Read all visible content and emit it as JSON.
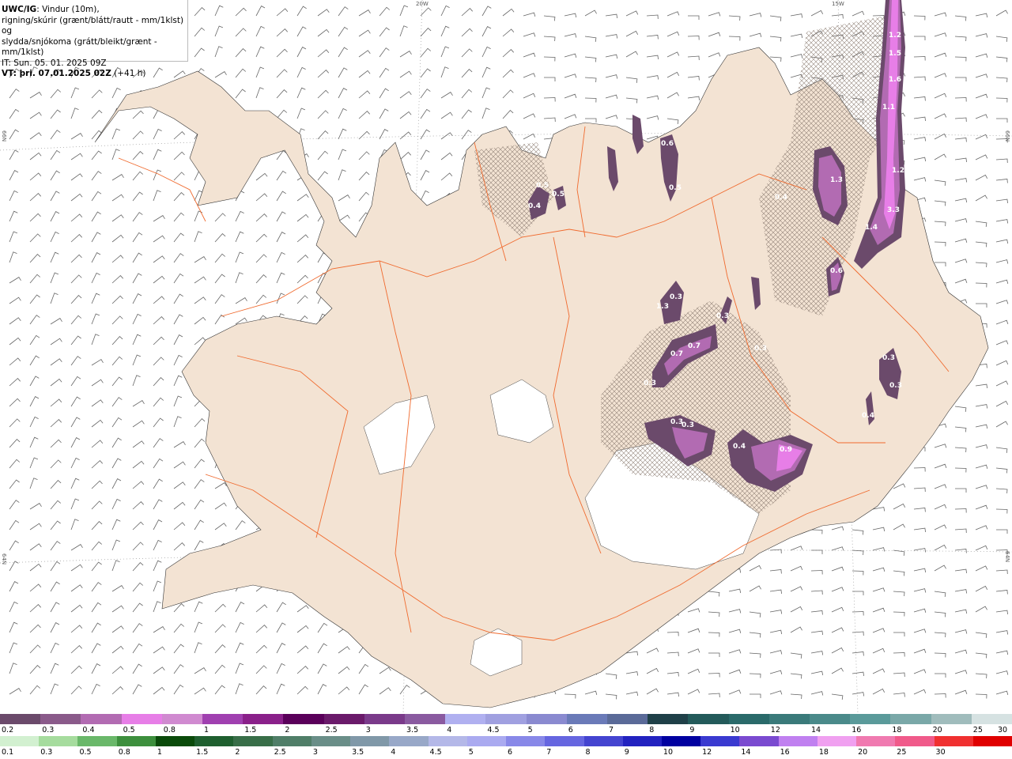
{
  "title": {
    "model": "UWC/IG",
    "line1_rest": ": Vindur (10m),",
    "line2": "rigning/skúrir (grænt/blátt/rautt - mm/1klst) og",
    "line3": "slydda/snjókoma (grátt/bleikt/grænt - mm/1klst)",
    "it_line": "IT: Sun. 05. 01. 2025 09Z",
    "vt_label": "VT: þri. 07.01.2025 02Z",
    "vt_offset": " (+41 h)"
  },
  "coords": {
    "top_20w": "20W",
    "top_15w": "15W",
    "left_66n": "66N",
    "left_64n": "64N",
    "right_66n": "66N",
    "right_64n": "64N"
  },
  "colors": {
    "land": "#f3e3d3",
    "road": "#f06a2e",
    "glacier": "#ffffff",
    "sea": "#ffffff",
    "wind_barb": "#666666"
  },
  "precip_labels": [
    "1.2",
    "1.5",
    "1.6",
    "1.1",
    "1.2",
    "3.3",
    "1.4",
    "1.3",
    "0.6",
    "0.6",
    "0.5",
    "0.5",
    "0.4",
    "0.5",
    "0.4",
    "1.3",
    "0.3",
    "0.3",
    "0.4",
    "0.7",
    "0.7",
    "0.3",
    "0.3",
    "0.3",
    "0.3",
    "0.4",
    "0.9",
    "0.3",
    "0.3"
  ],
  "legend_snow": {
    "colors": [
      "#6b4a6b",
      "#8a5a8a",
      "#b26bb2",
      "#e77ee7",
      "#d08ad0",
      "#a040b0",
      "#8a208a",
      "#5a005a",
      "#6a1a6a",
      "#7a3a8a",
      "#8a5aa0",
      "#b0b0f0",
      "#a0a0e0",
      "#8a8ad0",
      "#6a7ab8",
      "#5a6a98",
      "#1f4048",
      "#235a5a",
      "#2a6a6a",
      "#3a7a7a",
      "#4a8a8a",
      "#5a9a9a",
      "#7aa8a8",
      "#a0bcbc",
      "#d6e2e2"
    ],
    "labels": [
      "0.2",
      "0.3",
      "0.4",
      "0.5",
      "0.8",
      "1",
      "1.5",
      "2",
      "2.5",
      "3",
      "3.5",
      "4",
      "4.5",
      "5",
      "6",
      "7",
      "8",
      "9",
      "10",
      "12",
      "14",
      "16",
      "18",
      "20",
      "25",
      "30"
    ]
  },
  "legend_rain": {
    "colors": [
      "#d2f0d0",
      "#a6dc9e",
      "#6ab86a",
      "#3d8f3d",
      "#0a4a0a",
      "#1f5f2f",
      "#386e48",
      "#507e68",
      "#6a8e88",
      "#8098a8",
      "#98a8c8",
      "#b4b8e8",
      "#aaaaf0",
      "#8888e8",
      "#6666e0",
      "#4444d0",
      "#2222c0",
      "#0000a0",
      "#3a3ad0",
      "#7a4ad0",
      "#c080f0",
      "#f0a0f0",
      "#f07ab0",
      "#f05a8a",
      "#f03030",
      "#e00000"
    ],
    "labels": [
      "0.1",
      "0.3",
      "0.5",
      "0.8",
      "1",
      "1.5",
      "2",
      "2.5",
      "3",
      "3.5",
      "4",
      "4.5",
      "5",
      "6",
      "7",
      "8",
      "9",
      "10",
      "12",
      "14",
      "16",
      "18",
      "20",
      "25",
      "30"
    ]
  }
}
